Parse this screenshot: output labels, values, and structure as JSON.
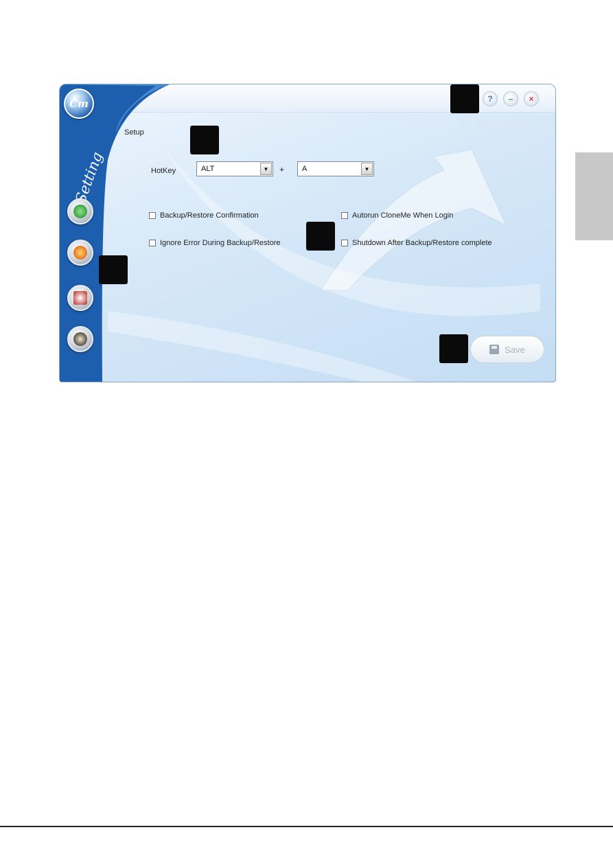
{
  "window": {
    "brand": "CloneMe",
    "logo_text": "Cm",
    "sidebar_title": "Setting"
  },
  "title_controls": {
    "help": "?",
    "minimize": "–",
    "close": "×"
  },
  "setup": {
    "section_label": "Setup",
    "hotkey_label": "HotKey",
    "modifier_value": "ALT",
    "plus": "+",
    "key_value": "A",
    "dropdown_arrow": "▼"
  },
  "options": {
    "backup_confirm": "Backup/Restore Confirmation",
    "autorun": "Autorun CloneMe When Login",
    "ignore_error": "Ignore Error During Backup/Restore",
    "shutdown_after": "Shutdown After Backup/Restore complete"
  },
  "save_button": {
    "label": "Save"
  },
  "nav_icons": [
    "backup-icon",
    "restore-icon",
    "schedule-icon",
    "settings-icon"
  ],
  "colors": {
    "sidebar_blue": "#1a5aa8",
    "window_bg": "#d6e8f8",
    "marker": "#0a0a0a"
  }
}
